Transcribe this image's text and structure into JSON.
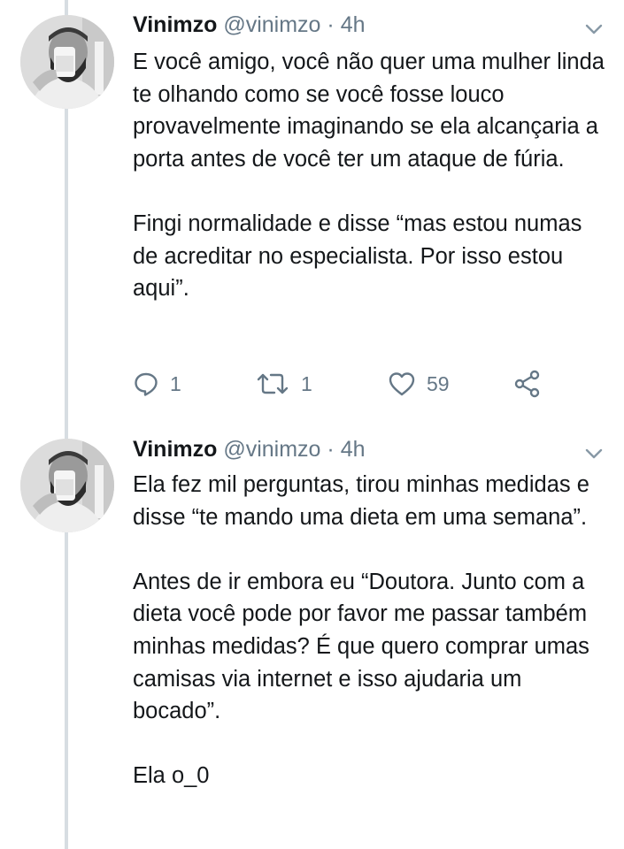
{
  "tweets": [
    {
      "author_name": "Vinimzo",
      "handle": "@vinimzo",
      "separator": "·",
      "time": "4h",
      "paragraphs": [
        "E você amigo, você não quer uma mulher linda te olhando como se você fosse louco provavelmente imaginando se ela alcançaria a porta antes de você ter um ataque de fúria.",
        "Fingi normalidade e disse “mas estou numas de acreditar no especialista. Por isso estou aqui”."
      ],
      "reply_count": "1",
      "retweet_count": "1",
      "like_count": "59"
    },
    {
      "author_name": "Vinimzo",
      "handle": "@vinimzo",
      "separator": "·",
      "time": "4h",
      "paragraphs": [
        "Ela fez mil perguntas, tirou minhas medidas e disse “te mando uma dieta em uma semana”.",
        "Antes de ir embora eu “Doutora. Junto com a dieta você pode por favor me passar também minhas medidas? É que quero comprar umas camisas via internet e isso ajudaria um bocado”.",
        "Ela o_0"
      ]
    }
  ],
  "icons": {
    "reply": "reply-icon",
    "retweet": "retweet-icon",
    "like": "heart-icon",
    "share": "share-icon",
    "menu": "chevron-down-icon",
    "avatar": "avatar-photo"
  },
  "colors": {
    "text": "#14171a",
    "secondary": "#657786",
    "thread_line": "#d7dde2"
  }
}
